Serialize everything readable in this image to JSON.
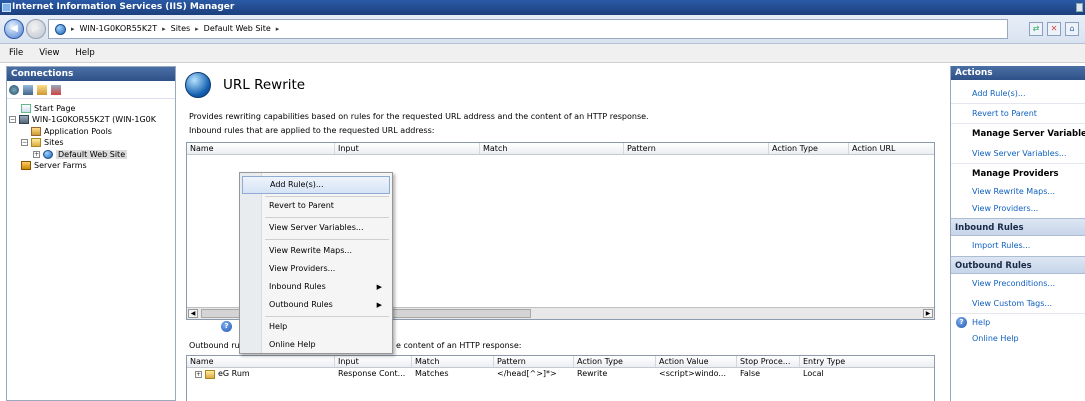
{
  "window": {
    "title": "Internet Information Services (IIS) Manager"
  },
  "address": {
    "crumbs": [
      "WIN-1G0KOR55K2T",
      "Sites",
      "Default Web Site"
    ],
    "separator": "▸"
  },
  "menu": {
    "file": "File",
    "view": "View",
    "help": "Help"
  },
  "connections": {
    "header": "Connections",
    "tree": {
      "start_page": "Start Page",
      "server": "WIN-1G0KOR55K2T (WIN-1G0K",
      "app_pools": "Application Pools",
      "sites": "Sites",
      "default_site": "Default Web Site",
      "server_farms": "Server Farms"
    }
  },
  "feature": {
    "title": "URL Rewrite",
    "description": "Provides rewriting capabilities based on rules for the requested URL address and the content of an HTTP response.",
    "inbound_label": "Inbound rules that are applied to the requested URL address:",
    "outbound_label_left": "Outbound rul",
    "outbound_label_right": "e content of an HTTP response:"
  },
  "inbound_columns": [
    "Name",
    "Input",
    "Match",
    "Pattern",
    "Action Type",
    "Action URL"
  ],
  "outbound_columns": [
    "Name",
    "Input",
    "Match",
    "Pattern",
    "Action Type",
    "Action Value",
    "Stop Proce...",
    "Entry Type"
  ],
  "outbound_rows": [
    {
      "name": "eG Rum",
      "input": "Response Cont...",
      "match": "Matches",
      "pattern": "</head[^>]*>",
      "action_type": "Rewrite",
      "action_value": "<script>windo...",
      "stop": "False",
      "entry_type": "Local"
    }
  ],
  "context_menu": {
    "add_rules": "Add Rule(s)...",
    "revert": "Revert to Parent",
    "view_server_vars": "View Server Variables...",
    "view_rewrite_maps": "View Rewrite Maps...",
    "view_providers": "View Providers...",
    "inbound_rules": "Inbound Rules",
    "outbound_rules": "Outbound Rules",
    "help": "Help",
    "online_help": "Online Help"
  },
  "actions": {
    "header": "Actions",
    "add_rules": "Add Rule(s)...",
    "revert": "Revert to Parent",
    "manage_server_vars": "Manage Server Variable",
    "view_server_vars": "View Server Variables...",
    "manage_providers": "Manage Providers",
    "view_rewrite_maps": "View Rewrite Maps...",
    "view_providers": "View Providers...",
    "inbound_group": "Inbound Rules",
    "import_rules": "Import Rules...",
    "outbound_group": "Outbound Rules",
    "view_preconditions": "View Preconditions...",
    "view_custom_tags": "View Custom Tags...",
    "help": "Help",
    "online_help": "Online Help"
  }
}
